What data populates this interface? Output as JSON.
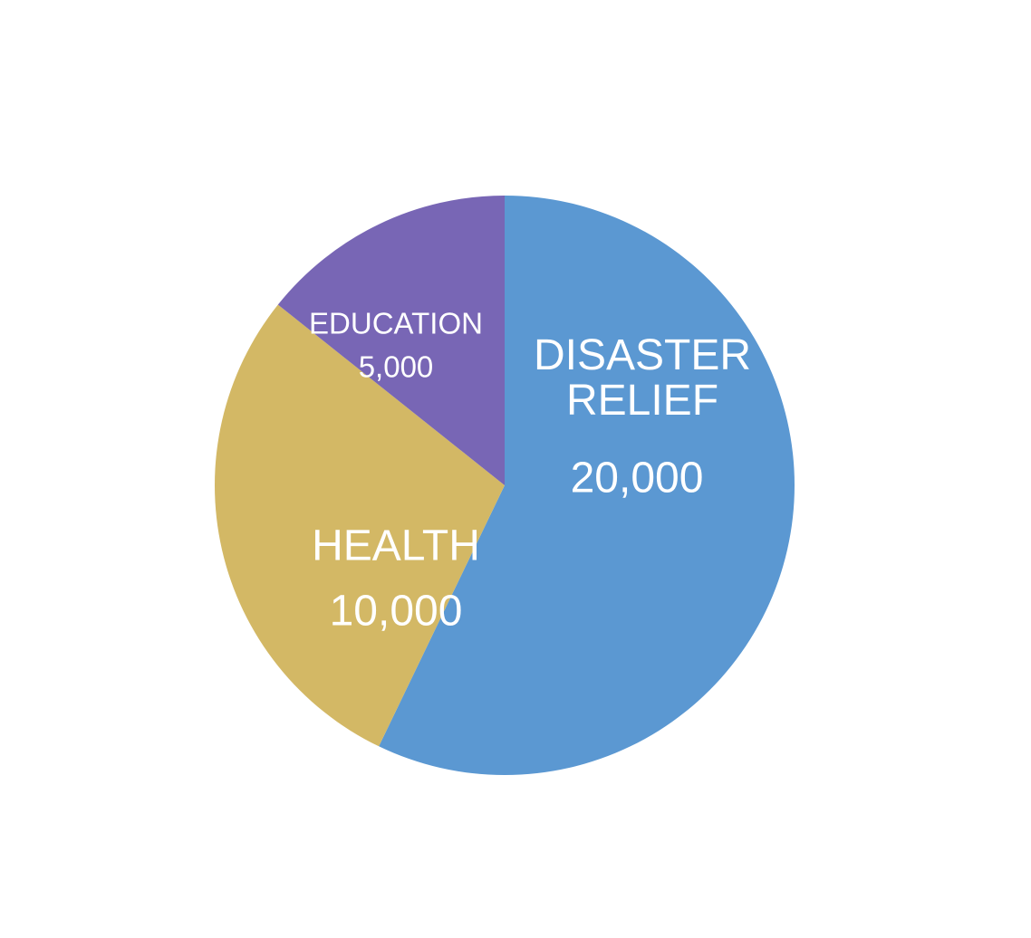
{
  "chart_data": {
    "type": "pie",
    "categories": [
      "DISASTER RELIEF",
      "HEALTH",
      "EDUCATION"
    ],
    "values": [
      20000,
      10000,
      5000
    ],
    "value_labels": [
      "20,000",
      "10,000",
      "5,000"
    ],
    "colors": [
      "#5b98d2",
      "#d3b865",
      "#7866b5"
    ],
    "start_angle_deg": 0,
    "direction": "clockwise",
    "legend": "none",
    "title": ""
  }
}
